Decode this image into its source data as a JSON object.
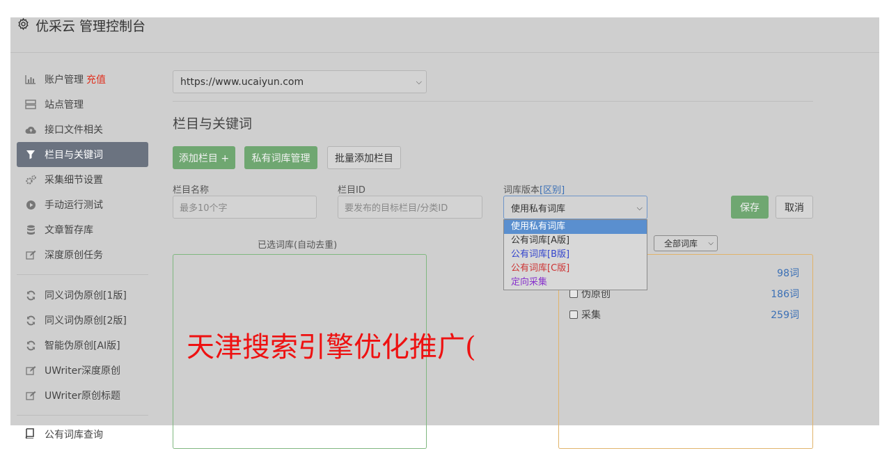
{
  "app": {
    "title": "优采云 管理控制台",
    "icon": "gear-icon"
  },
  "sidebar": {
    "items": [
      {
        "label": "账户管理",
        "icon": "bar-chart-icon",
        "badge": "充值"
      },
      {
        "label": "站点管理",
        "icon": "server-icon"
      },
      {
        "label": "接口文件相关",
        "icon": "cloud-upload-icon"
      },
      {
        "label": "栏目与关键词",
        "icon": "filter-icon",
        "active": true
      },
      {
        "label": "采集细节设置",
        "icon": "gears-icon"
      },
      {
        "label": "手动运行测试",
        "icon": "play-circle-icon"
      },
      {
        "label": "文章暂存库",
        "icon": "database-icon"
      },
      {
        "label": "深度原创任务",
        "icon": "edit-icon"
      }
    ],
    "items2": [
      {
        "label": "同义词伪原创[1版]",
        "icon": "refresh-icon"
      },
      {
        "label": "同义词伪原创[2版]",
        "icon": "refresh-icon"
      },
      {
        "label": "智能伪原创[AI版]",
        "icon": "refresh-icon"
      },
      {
        "label": "UWriter深度原创",
        "icon": "edit-icon"
      },
      {
        "label": "UWriter原创标题",
        "icon": "edit-icon"
      }
    ],
    "items3": [
      {
        "label": "公有词库查询",
        "icon": "book-icon"
      }
    ]
  },
  "main": {
    "site_select": "https://www.ucaiyun.com",
    "section_title": "栏目与关键词",
    "buttons": {
      "add_column": "添加栏目 +",
      "private_lib": "私有词库管理",
      "batch_add": "批量添加栏目"
    },
    "form": {
      "name_label": "栏目名称",
      "name_placeholder": "最多10个字",
      "id_label": "栏目ID",
      "id_placeholder": "要发布的目标栏目/分类ID",
      "version_label": "词库版本",
      "version_link": "[区别]",
      "version_value": "使用私有词库",
      "save": "保存",
      "cancel": "取消"
    },
    "dropdown_options": [
      {
        "label": "使用私有词库",
        "color": "#ffffff",
        "selected": true
      },
      {
        "label": "公有词库[A版]",
        "color": "#333333"
      },
      {
        "label": "公有词库[B版]",
        "color": "#3344cc"
      },
      {
        "label": "公有词库[C版]",
        "color": "#cc3333"
      },
      {
        "label": "定向采集",
        "color": "#8833cc"
      }
    ],
    "selected_caption": "已选词库(自动去重)",
    "filter_value": "全部词库",
    "libraries": [
      {
        "name": "",
        "count": "98词"
      },
      {
        "name": "伪原创",
        "count": "186词"
      },
      {
        "name": "采集",
        "count": "259词"
      }
    ]
  },
  "overlay": {
    "text": "天津搜索引擎优化推广("
  },
  "colors": {
    "accent_green": "#6fa771",
    "active_nav": "#6b7380",
    "link_blue": "#3a6fb5",
    "recharge_red": "#e0301e"
  }
}
